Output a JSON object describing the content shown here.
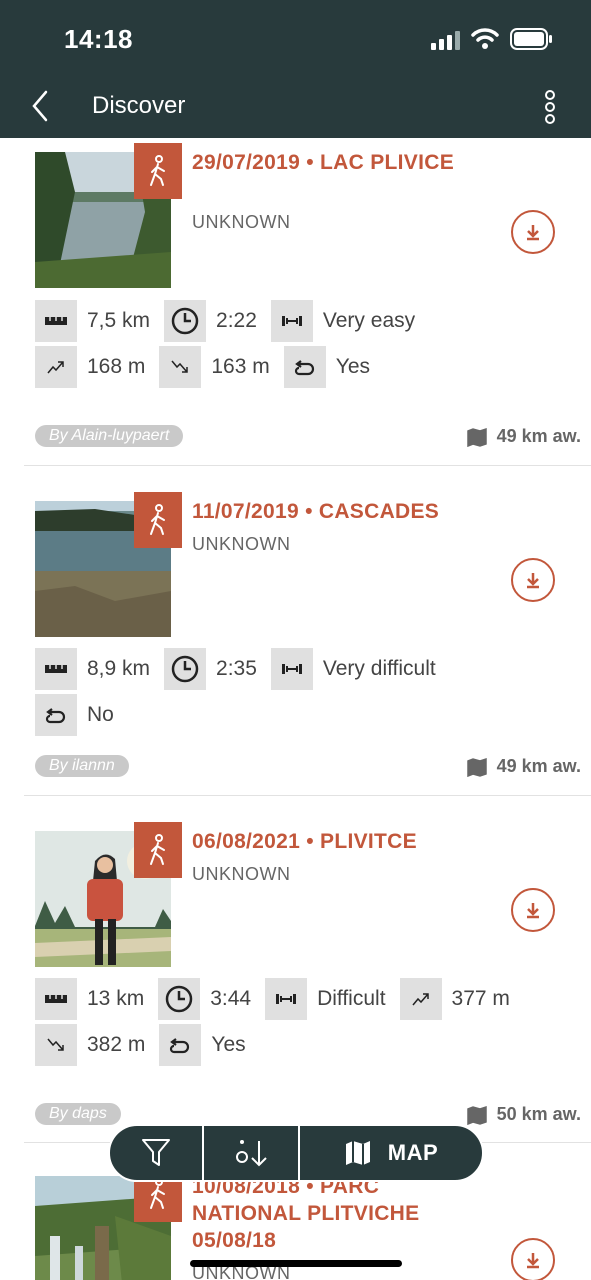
{
  "status_bar": {
    "time": "14:18"
  },
  "app_bar": {
    "title": "Discover"
  },
  "colors": {
    "accent": "#c2573b",
    "bar": "#283a3c",
    "stat_bg": "#e0e0e0",
    "author_bg": "#c9c9c9"
  },
  "cards": [
    {
      "title": "29/07/2019 • LAC PLIVICE",
      "subtitle": "UNKNOWN",
      "activity_icon": "hiking-icon",
      "stats": {
        "distance": "7,5 km",
        "duration": "2:22",
        "difficulty": "Very easy",
        "ascent": "168 m",
        "descent": "163 m",
        "loop": "Yes"
      },
      "author": "By Alain-luypaert",
      "distance_away": "49 km aw."
    },
    {
      "title": "11/07/2019 • CASCADES",
      "subtitle": "UNKNOWN",
      "activity_icon": "hiking-icon",
      "stats": {
        "distance": "8,9 km",
        "duration": "2:35",
        "difficulty": "Very difficult",
        "loop": "No"
      },
      "author": "By ilannn",
      "distance_away": "49 km aw."
    },
    {
      "title": "06/08/2021 • PLIVITCE",
      "subtitle": "UNKNOWN",
      "activity_icon": "hiking-icon",
      "stats": {
        "distance": "13 km",
        "duration": "3:44",
        "difficulty": "Difficult",
        "ascent": "377 m",
        "descent": "382 m",
        "loop": "Yes"
      },
      "author": "By daps",
      "distance_away": "50 km aw."
    },
    {
      "title": "10/08/2018 • PARC NATIONAL PLITVICHE 05/08/18",
      "subtitle": "UNKNOWN",
      "activity_icon": "hiking-icon"
    }
  ],
  "fab": {
    "filter_icon": "filter-icon",
    "sort_icon": "sort-icon",
    "map_label": "MAP"
  }
}
